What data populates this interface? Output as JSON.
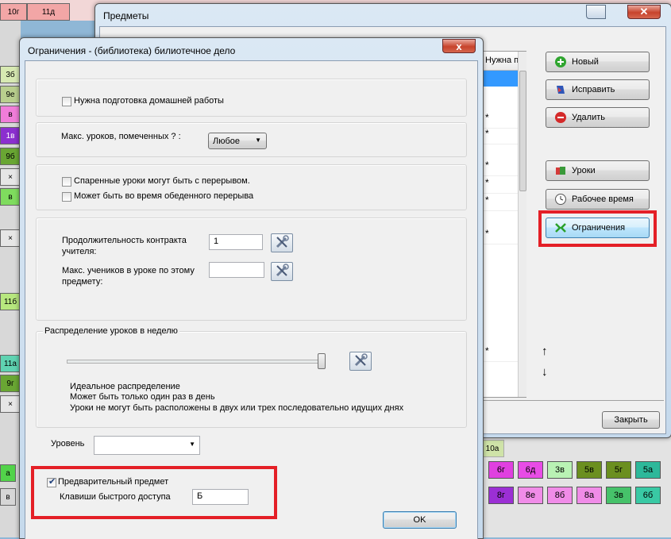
{
  "background": {
    "top_cells": [
      "10г",
      "11д"
    ],
    "left_cells": [
      "3б",
      "9е",
      "в",
      "1в",
      "9б",
      "×",
      "в",
      "×",
      "11б",
      "11а",
      "9г",
      "×",
      "а",
      "в"
    ],
    "bottom_label": "10а",
    "bottom_row1": [
      {
        "text": "6г",
        "color": "#e040e0"
      },
      {
        "text": "6д",
        "color": "#e84ce6"
      },
      {
        "text": "3в",
        "color": "#b9f2b4"
      },
      {
        "text": "5в",
        "color": "#6b8f1f"
      },
      {
        "text": "5г",
        "color": "#6b8f1f"
      },
      {
        "text": "5а",
        "color": "#2db89a"
      }
    ],
    "bottom_row2": [
      {
        "text": "8г",
        "color": "#9b2fd4"
      },
      {
        "text": "8е",
        "color": "#f08ce8"
      },
      {
        "text": "8б",
        "color": "#f08ce8"
      },
      {
        "text": "8а",
        "color": "#f08ce8"
      },
      {
        "text": "3в",
        "color": "#46c26a"
      },
      {
        "text": "6б",
        "color": "#39c9a4"
      }
    ]
  },
  "predmety_window": {
    "title": "Предметы",
    "list_header": "Нужна п",
    "list_marks": [
      "*",
      "*",
      "*",
      "*",
      "*",
      "*",
      "*"
    ],
    "buttons": {
      "new": "Новый",
      "edit": "Исправить",
      "delete": "Удалить",
      "lessons": "Уроки",
      "work_time": "Рабочее время",
      "constraints": "Ограничения",
      "close": "Закрыть"
    },
    "arrow_up": "↑",
    "arrow_down": "↓"
  },
  "dialog": {
    "title": "Ограничения - (библиотека) билиотечное дело",
    "close_glyph": "x",
    "homework_label": "Нужна подготовка домашней работы",
    "max_marked_label": "Макс. уроков, помеченных ? :",
    "max_marked_value": "Любое",
    "double_lessons_break": "Спаренные уроки могут быть с перерывом.",
    "lunch_break": "Может быть во время обеденного перерыва",
    "contract_label_1": "Продолжительность контракта",
    "contract_label_2": "учителя:",
    "contract_value": "1",
    "max_students_label_1": "Макс. учеников в уроке по этому",
    "max_students_label_2": "предмету:",
    "max_students_value": "",
    "distribution_title": "Распределение уроков в неделю",
    "distribution_slider_level": 1.0,
    "distribution_lines": [
      "Идеальное распределение",
      "Может быть только один раз в день",
      "Уроки не могут быть расположены в двух или трех последовательно идущих днях"
    ],
    "level_label": "Уровень",
    "level_value": "",
    "preliminary_label": "Предварительный предмет",
    "preliminary_checked": true,
    "hotkey_label": "Клавиши быстрого доступа",
    "hotkey_value": "Б",
    "ok_label": "OK"
  }
}
